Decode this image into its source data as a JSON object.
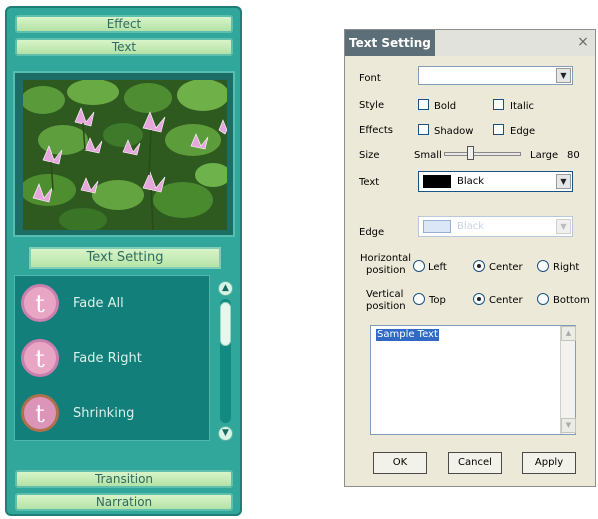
{
  "left_panel": {
    "tabs": {
      "effect": "Effect",
      "text": "Text",
      "transition": "Transition",
      "narration": "Narration"
    },
    "text_setting_button": "Text Setting",
    "effects": [
      {
        "icon": "t",
        "label": "Fade All"
      },
      {
        "icon": "t",
        "label": "Fade Right"
      },
      {
        "icon": "t",
        "label": "Shrinking"
      }
    ],
    "scroll_up_icon": "▲",
    "scroll_down_icon": "▼"
  },
  "dialog": {
    "title": "Text Setting",
    "close_icon": "×",
    "font": {
      "label": "Font",
      "value": ""
    },
    "style": {
      "label": "Style",
      "bold": "Bold",
      "italic": "Italic"
    },
    "effects": {
      "label": "Effects",
      "shadow": "Shadow",
      "edge": "Edge"
    },
    "size": {
      "label": "Size",
      "small": "Small",
      "large": "Large",
      "value": "80"
    },
    "text_color": {
      "label": "Text",
      "value": "Black",
      "swatch": "#000000"
    },
    "edge_color": {
      "label": "Edge",
      "value": "Black",
      "swatch": "#dbe6f6"
    },
    "horizontal": {
      "label_line1": "Horizontal",
      "label_line2": "position",
      "left": "Left",
      "center": "Center",
      "right": "Right",
      "selected": "center"
    },
    "vertical": {
      "label_line1": "Vertical",
      "label_line2": "position",
      "top": "Top",
      "center": "Center",
      "bottom": "Bottom",
      "selected": "center"
    },
    "sample_text": "Sample Text",
    "buttons": {
      "ok": "OK",
      "cancel": "Cancel",
      "apply": "Apply"
    }
  },
  "drop_arrow": "▼"
}
